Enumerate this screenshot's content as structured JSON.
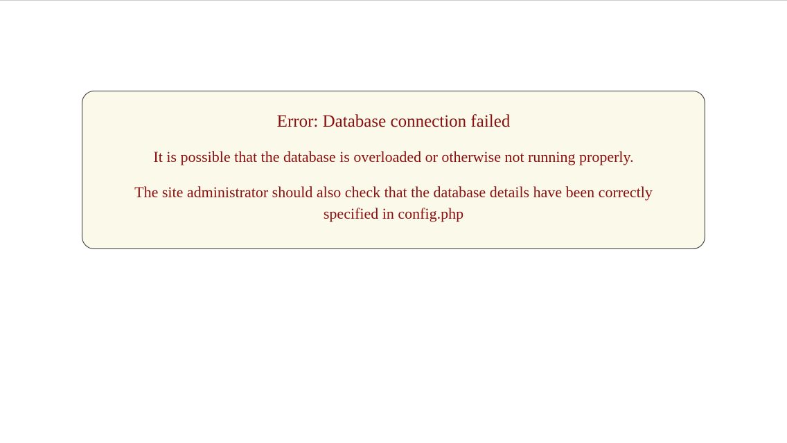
{
  "error": {
    "title": "Error: Database connection failed",
    "message1": "It is possible that the database is overloaded or otherwise not running properly.",
    "message2": "The site administrator should also check that the database details have been correctly specified in config.php"
  }
}
